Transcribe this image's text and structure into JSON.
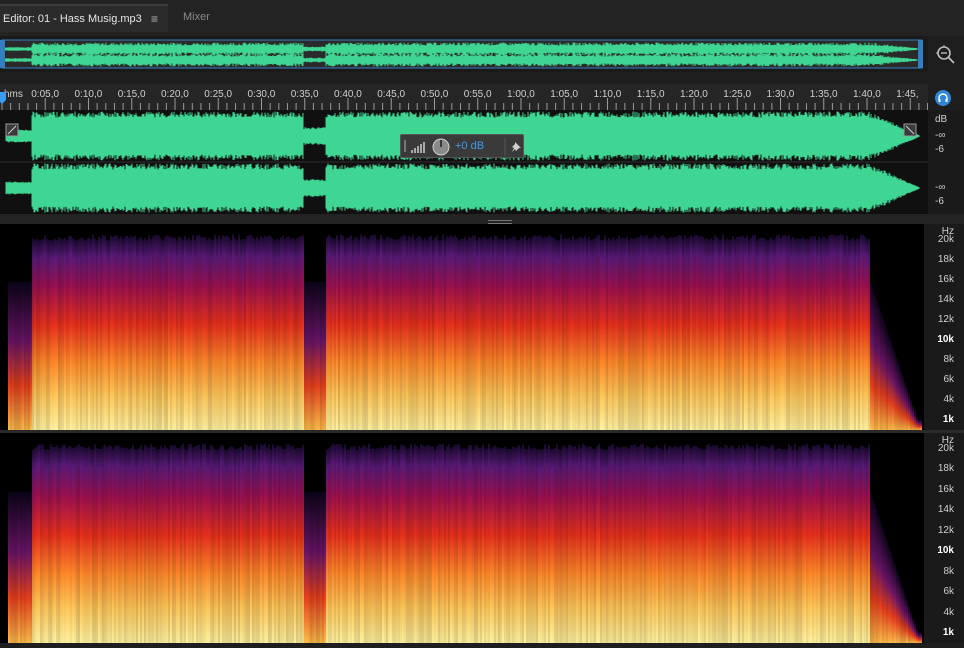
{
  "tabs": {
    "editor_label": "Editor: 01 - Hass Musig.mp3",
    "menu_icon": "≡",
    "mixer_label": "Mixer"
  },
  "ruler": {
    "unit": "hms",
    "ticks": [
      "0:05,0",
      "0:10,0",
      "0:15,0",
      "0:20,0",
      "0:25,0",
      "0:30,0",
      "0:35,0",
      "0:40,0",
      "0:45,0",
      "0:50,0",
      "0:55,0",
      "1:00,0",
      "1:05,0",
      "1:10,0",
      "1:15,0",
      "1:20,0",
      "1:25,0",
      "1:30,0",
      "1:35,0",
      "1:40,0",
      "1:45,"
    ]
  },
  "waveform": {
    "color": "#3fd592",
    "db_top": {
      "unit": "dB",
      "inf": "-∞",
      "minus6": "-6"
    },
    "db_bottom": {
      "inf": "-∞",
      "minus6": "-6"
    }
  },
  "hud": {
    "value": "+0 dB"
  },
  "spectrogram": {
    "hz_unit": "Hz",
    "labels": [
      {
        "text": "20k",
        "bold": false
      },
      {
        "text": "18k",
        "bold": false
      },
      {
        "text": "16k",
        "bold": false
      },
      {
        "text": "14k",
        "bold": false
      },
      {
        "text": "12k",
        "bold": false
      },
      {
        "text": "10k",
        "bold": true
      },
      {
        "text": "8k",
        "bold": false
      },
      {
        "text": "6k",
        "bold": false
      },
      {
        "text": "4k",
        "bold": false
      },
      {
        "text": "1k",
        "bold": true
      }
    ]
  }
}
